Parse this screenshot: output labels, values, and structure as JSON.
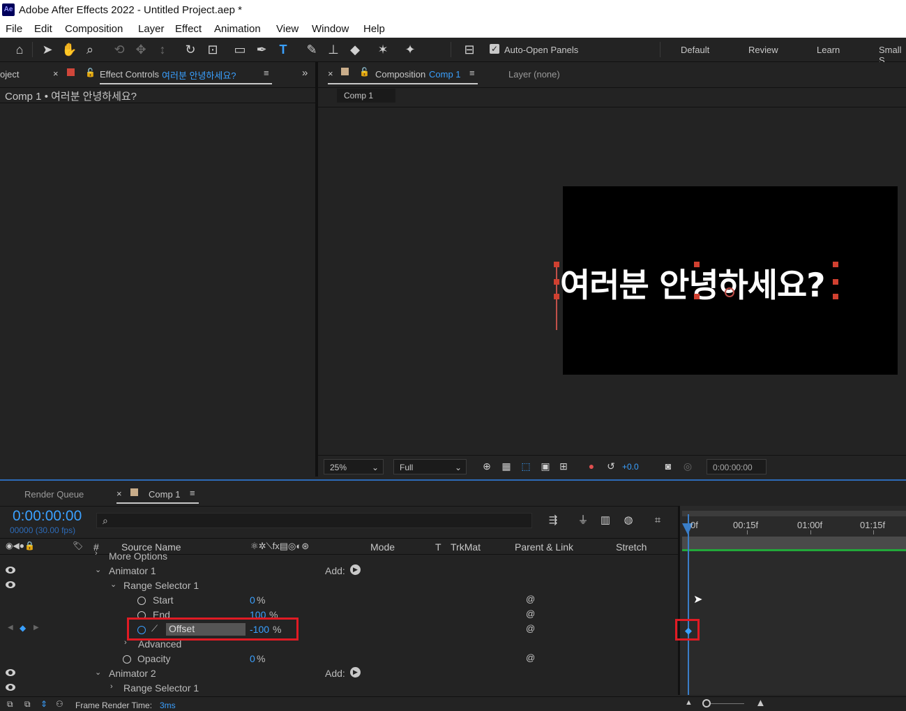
{
  "title": "Adobe After Effects 2022 - Untitled Project.aep *",
  "logo": "Ae",
  "menu": [
    "File",
    "Edit",
    "Composition",
    "Layer",
    "Effect",
    "Animation",
    "View",
    "Window",
    "Help"
  ],
  "toolbar": {
    "auto_open": "Auto-Open Panels",
    "workspaces": [
      "Default",
      "Review",
      "Learn",
      "Small S"
    ]
  },
  "left_panel": {
    "project_tab": "oject",
    "effect_tab": "Effect Controls",
    "effect_layer": "여러분 안녕하세요?",
    "breadcrumb": "Comp 1 • 여러분 안녕하세요?"
  },
  "comp_panel": {
    "tab": "Composition",
    "tab_name": "Comp 1",
    "layer_tab": "Layer (none)",
    "subtab": "Comp 1",
    "text": "여러분 안녕하세요?",
    "zoom": "25%",
    "resolution": "Full",
    "exposure": "+0.0",
    "timecode": "0:00:00:00"
  },
  "timeline": {
    "render_queue": "Render Queue",
    "comp_tab": "Comp 1",
    "time": "0:00:00:00",
    "fps": "00000 (30.00 fps)",
    "columns": {
      "hash": "#",
      "source": "Source Name",
      "mode": "Mode",
      "t": "T",
      "trkmat": "TrkMat",
      "parent": "Parent & Link",
      "stretch": "Stretch"
    },
    "ruler": [
      "0f",
      "00:15f",
      "01:00f",
      "01:15f"
    ],
    "rows": {
      "more": "More Options",
      "animator1": "Animator 1",
      "add1": "Add:",
      "range1": "Range Selector 1",
      "start": "Start",
      "start_val": "0",
      "end": "End",
      "end_val": "100",
      "offset": "Offset",
      "offset_val": "-100",
      "advanced": "Advanced",
      "opacity": "Opacity",
      "opacity_val": "0",
      "animator2": "Animator 2",
      "add2": "Add:",
      "range2": "Range Selector 1"
    },
    "pct": "%",
    "frame_render": "Frame Render Time:",
    "frame_render_val": "3ms"
  }
}
